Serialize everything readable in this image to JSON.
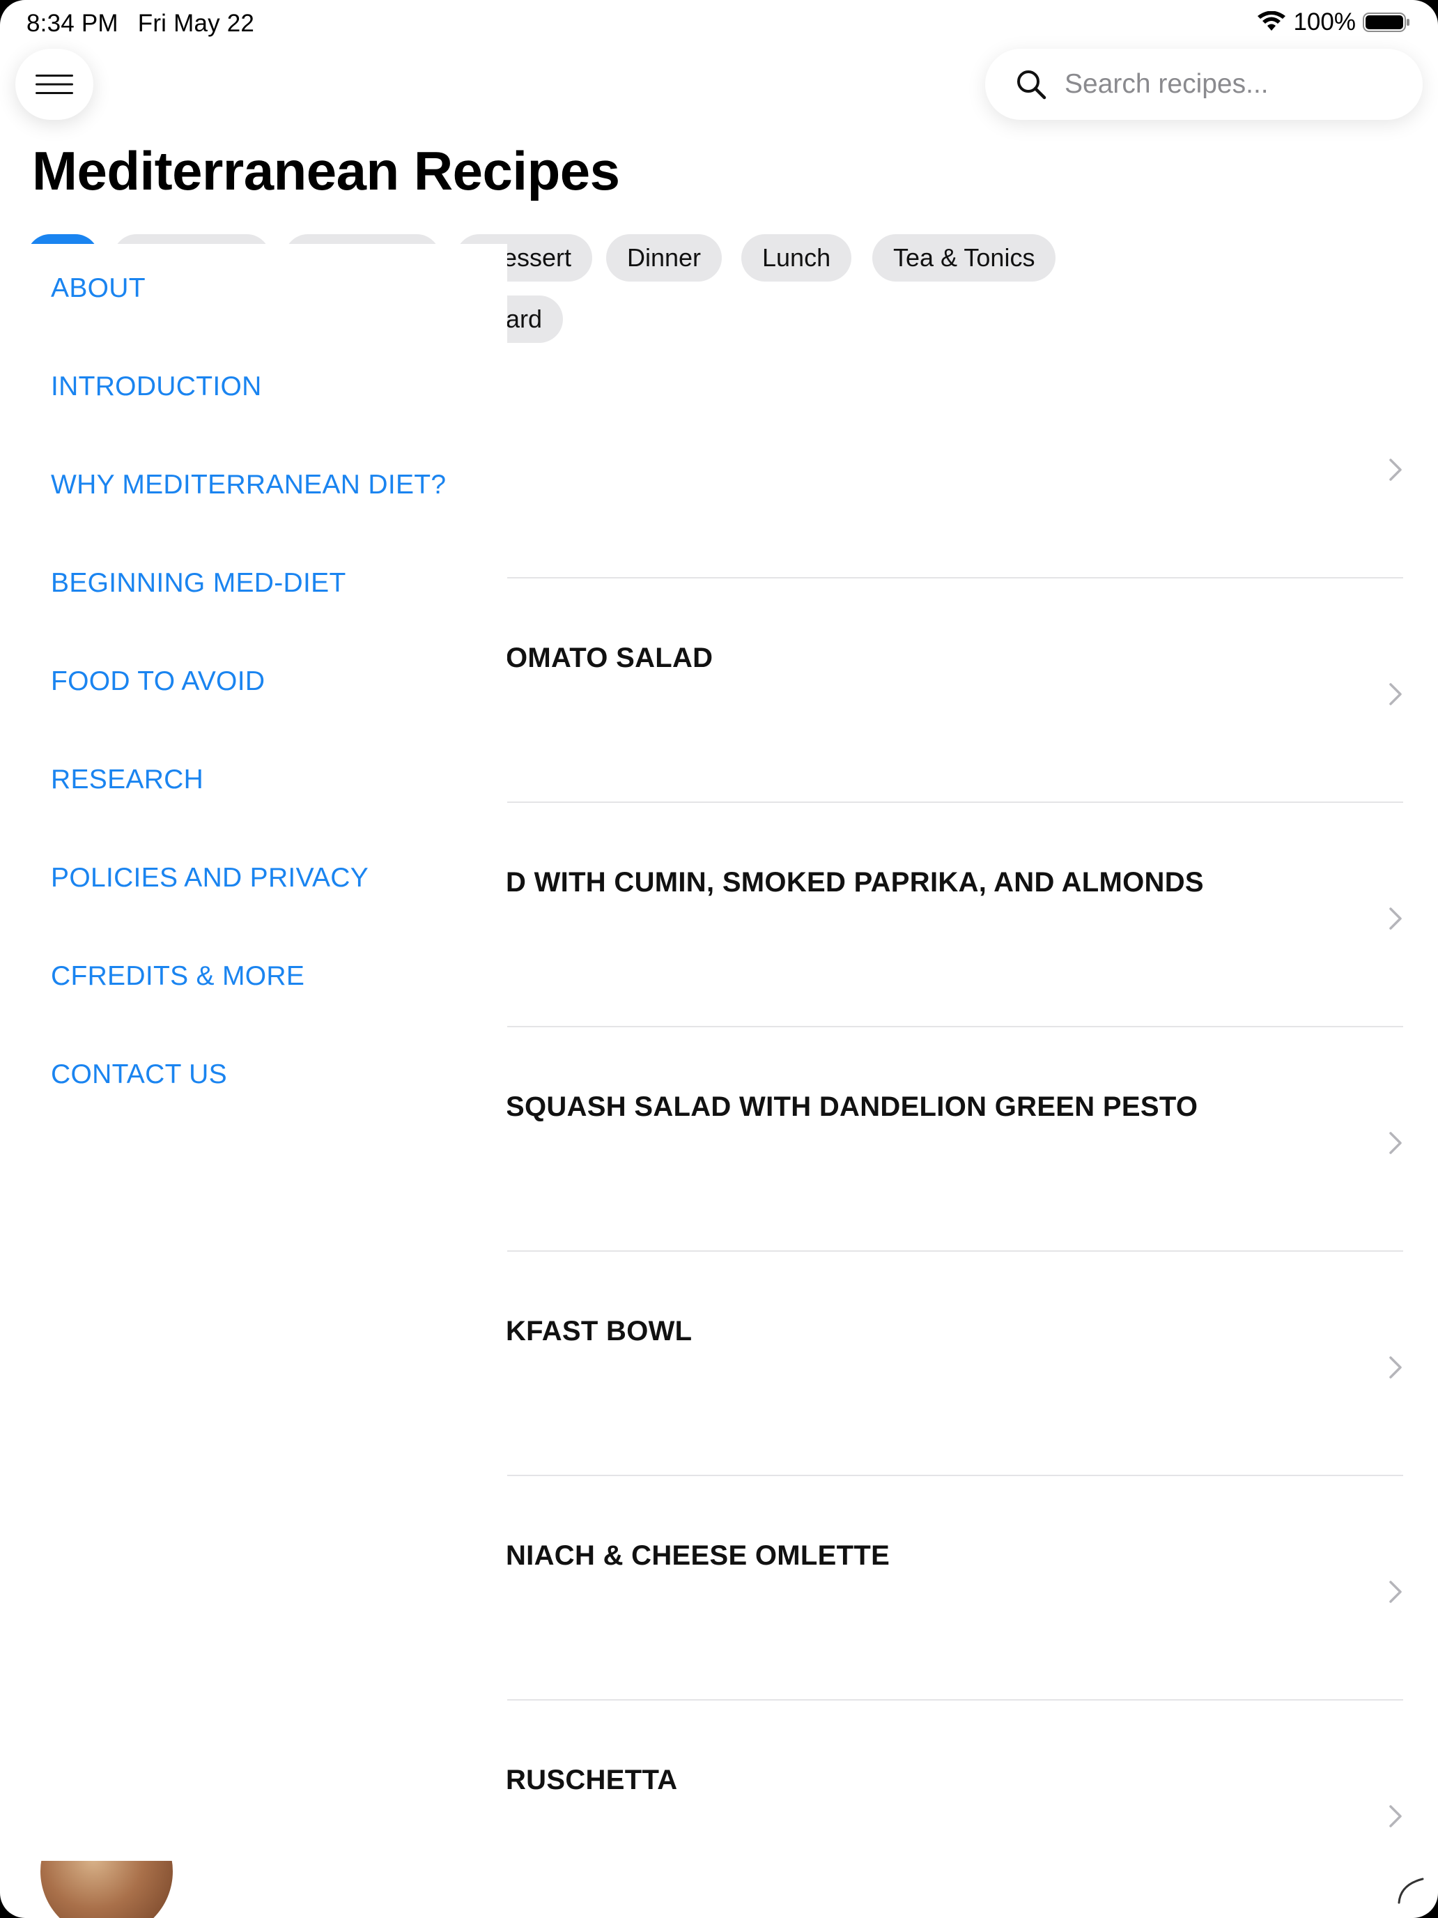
{
  "status_bar": {
    "time": "8:34 PM",
    "date": "Fri May 22",
    "battery": "100%"
  },
  "header": {
    "title": "Mediterranean Recipes",
    "search_placeholder": "Search recipes..."
  },
  "filters": {
    "chips": [
      {
        "label": "",
        "active": true
      },
      {
        "label": "",
        "active": false
      },
      {
        "label": "",
        "active": false
      },
      {
        "label": "essert",
        "active": false
      },
      {
        "label": "Dinner",
        "active": false
      },
      {
        "label": "Lunch",
        "active": false
      },
      {
        "label": "Tea & Tonics",
        "active": false
      },
      {
        "label": "ard",
        "active": false
      }
    ]
  },
  "recipes": [
    {
      "title": ""
    },
    {
      "title": "OMATO SALAD"
    },
    {
      "title": "D WITH CUMIN, SMOKED PAPRIKA, AND ALMONDS"
    },
    {
      "title": "SQUASH SALAD WITH DANDELION GREEN PESTO"
    },
    {
      "title": "KFAST BOWL"
    },
    {
      "title": "NIACH & CHEESE OMLETTE"
    },
    {
      "title": "RUSCHETTA"
    }
  ],
  "drawer": {
    "items": [
      {
        "label": "ABOUT"
      },
      {
        "label": "INTRODUCTION"
      },
      {
        "label": "WHY MEDITERRANEAN DIET?"
      },
      {
        "label": "BEGINNING MED-DIET"
      },
      {
        "label": "FOOD TO AVOID"
      },
      {
        "label": "RESEARCH"
      },
      {
        "label": "POLICIES AND PRIVACY"
      },
      {
        "label": "CFREDITS & MORE"
      },
      {
        "label": "CONTACT US"
      }
    ]
  },
  "colors": {
    "accent": "#1a84f0",
    "chip_bg": "#e7e7e9",
    "divider": "#e4e4e6"
  }
}
